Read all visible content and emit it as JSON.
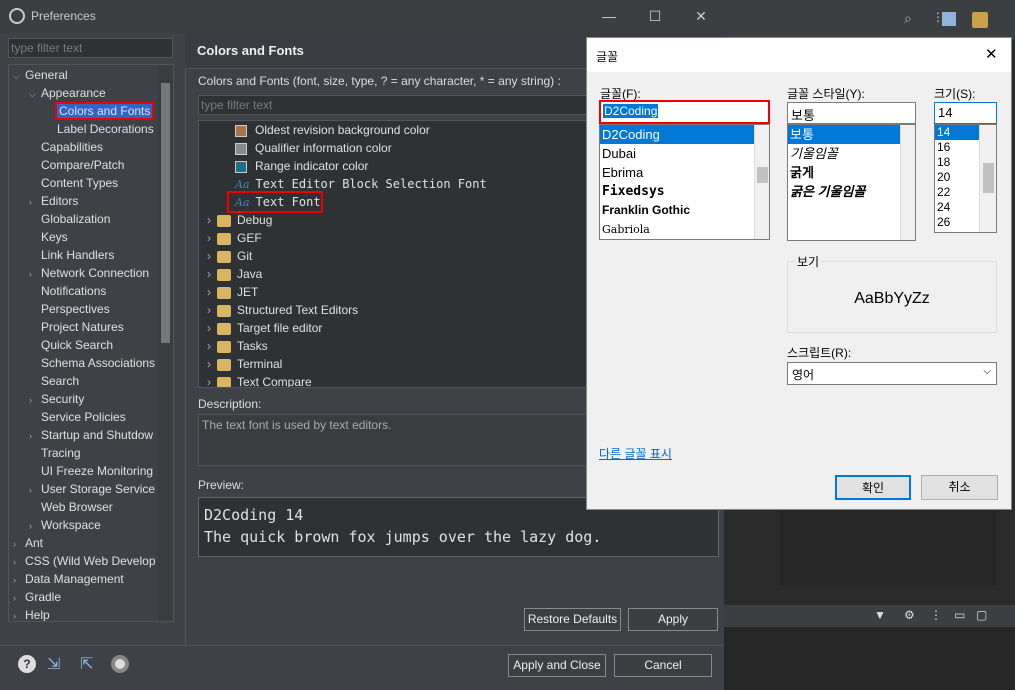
{
  "window": {
    "title": "Preferences",
    "min": "—",
    "max": "☐",
    "close": "✕"
  },
  "filter_placeholder": "type filter text",
  "tree": [
    {
      "label": "General",
      "arrow": "⌵",
      "level": 0
    },
    {
      "label": "Appearance",
      "arrow": "⌵",
      "level": 1
    },
    {
      "label": "Colors and Fonts",
      "arrow": "",
      "level": 2,
      "selected": true
    },
    {
      "label": "Label Decorations",
      "arrow": "",
      "level": 2
    },
    {
      "label": "Capabilities",
      "arrow": "",
      "level": 1
    },
    {
      "label": "Compare/Patch",
      "arrow": "",
      "level": 1
    },
    {
      "label": "Content Types",
      "arrow": "",
      "level": 1
    },
    {
      "label": "Editors",
      "arrow": "›",
      "level": 1
    },
    {
      "label": "Globalization",
      "arrow": "",
      "level": 1
    },
    {
      "label": "Keys",
      "arrow": "",
      "level": 1
    },
    {
      "label": "Link Handlers",
      "arrow": "",
      "level": 1
    },
    {
      "label": "Network Connection",
      "arrow": "›",
      "level": 1
    },
    {
      "label": "Notifications",
      "arrow": "",
      "level": 1
    },
    {
      "label": "Perspectives",
      "arrow": "",
      "level": 1
    },
    {
      "label": "Project Natures",
      "arrow": "",
      "level": 1
    },
    {
      "label": "Quick Search",
      "arrow": "",
      "level": 1
    },
    {
      "label": "Schema Associations",
      "arrow": "",
      "level": 1
    },
    {
      "label": "Search",
      "arrow": "",
      "level": 1
    },
    {
      "label": "Security",
      "arrow": "›",
      "level": 1
    },
    {
      "label": "Service Policies",
      "arrow": "",
      "level": 1
    },
    {
      "label": "Startup and Shutdow",
      "arrow": "›",
      "level": 1
    },
    {
      "label": "Tracing",
      "arrow": "",
      "level": 1
    },
    {
      "label": "UI Freeze Monitoring",
      "arrow": "",
      "level": 1
    },
    {
      "label": "User Storage Service",
      "arrow": "›",
      "level": 1
    },
    {
      "label": "Web Browser",
      "arrow": "",
      "level": 1
    },
    {
      "label": "Workspace",
      "arrow": "›",
      "level": 1
    },
    {
      "label": "Ant",
      "arrow": "›",
      "level": 0
    },
    {
      "label": "CSS (Wild Web Develop",
      "arrow": "›",
      "level": 0
    },
    {
      "label": "Data Management",
      "arrow": "›",
      "level": 0
    },
    {
      "label": "Gradle",
      "arrow": "›",
      "level": 0
    },
    {
      "label": "Help",
      "arrow": "›",
      "level": 0
    }
  ],
  "page_title": "Colors and Fonts",
  "page_desc": "Colors and Fonts (font, size, type, ? = any character, * = any string) :",
  "items": [
    {
      "label": "Oldest revision background color",
      "kind": "color",
      "color": "#a8724a"
    },
    {
      "label": "Qualifier information color",
      "kind": "color",
      "color": "#8a8a8a"
    },
    {
      "label": "Range indicator color",
      "kind": "color",
      "color": "#1b6f8a"
    },
    {
      "label": "Text Editor Block Selection Font",
      "kind": "font"
    },
    {
      "label": "Text Font",
      "kind": "font",
      "highlighted": true
    },
    {
      "label": "Debug",
      "kind": "folder"
    },
    {
      "label": "GEF",
      "kind": "folder"
    },
    {
      "label": "Git",
      "kind": "folder"
    },
    {
      "label": "Java",
      "kind": "folder"
    },
    {
      "label": "JET",
      "kind": "folder"
    },
    {
      "label": "Structured Text Editors",
      "kind": "folder"
    },
    {
      "label": "Target file editor",
      "kind": "folder"
    },
    {
      "label": "Tasks",
      "kind": "folder"
    },
    {
      "label": "Terminal",
      "kind": "folder"
    },
    {
      "label": "Text Compare",
      "kind": "folder"
    }
  ],
  "font_glyph": "Aa",
  "description": {
    "label": "Description:",
    "text": "The text font is used by text editors."
  },
  "preview": {
    "label": "Preview:",
    "line1": "D2Coding 14",
    "line2": "The quick brown fox jumps over the lazy dog."
  },
  "buttons": {
    "restore": "Restore Defaults",
    "apply": "Apply",
    "apply_close": "Apply and Close",
    "cancel": "Cancel"
  },
  "dialog": {
    "title": "글꼴",
    "close": "✕",
    "font_label": "글꼴(F):",
    "font_value": "D2Coding",
    "fonts": [
      "D2Coding",
      "Dubai",
      "Ebrima",
      "Fixedsys",
      "Franklin Gothic",
      "Gabriola"
    ],
    "style_label": "글꼴 스타일(Y):",
    "style_value": "보통",
    "styles": [
      "보통",
      "기울임꼴",
      "굵게",
      "굵은 기울임꼴"
    ],
    "size_label": "크기(S):",
    "size_value": "14",
    "sizes": [
      "14",
      "16",
      "18",
      "20",
      "22",
      "24",
      "26"
    ],
    "sample_label": "보기",
    "sample_text": "AaBbYyZz",
    "script_label": "스크립트(R):",
    "script_value": "영어",
    "more_fonts": "다른 글꼴 표시",
    "ok": "확인",
    "cancel": "취소"
  }
}
